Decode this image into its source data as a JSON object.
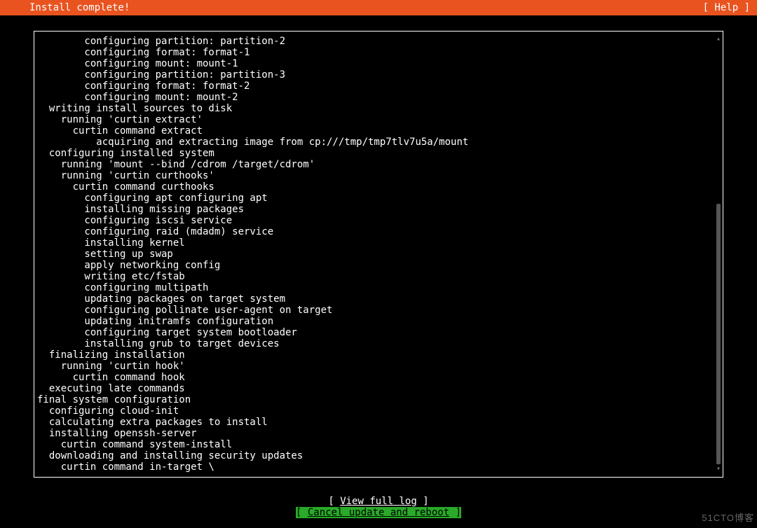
{
  "header": {
    "title": "Install complete!",
    "help": "[ Help ]"
  },
  "log": {
    "lines": [
      {
        "indent": 4,
        "text": "configuring partition: partition-2"
      },
      {
        "indent": 4,
        "text": "configuring format: format-1"
      },
      {
        "indent": 4,
        "text": "configuring mount: mount-1"
      },
      {
        "indent": 4,
        "text": "configuring partition: partition-3"
      },
      {
        "indent": 4,
        "text": "configuring format: format-2"
      },
      {
        "indent": 4,
        "text": "configuring mount: mount-2"
      },
      {
        "indent": 1,
        "text": "writing install sources to disk"
      },
      {
        "indent": 2,
        "text": "running 'curtin extract'"
      },
      {
        "indent": 3,
        "text": "curtin command extract"
      },
      {
        "indent": 5,
        "text": "acquiring and extracting image from cp:///tmp/tmp7tlv7u5a/mount"
      },
      {
        "indent": 1,
        "text": "configuring installed system"
      },
      {
        "indent": 2,
        "text": "running 'mount --bind /cdrom /target/cdrom'"
      },
      {
        "indent": 2,
        "text": "running 'curtin curthooks'"
      },
      {
        "indent": 3,
        "text": "curtin command curthooks"
      },
      {
        "indent": 4,
        "text": "configuring apt configuring apt"
      },
      {
        "indent": 4,
        "text": "installing missing packages"
      },
      {
        "indent": 4,
        "text": "configuring iscsi service"
      },
      {
        "indent": 4,
        "text": "configuring raid (mdadm) service"
      },
      {
        "indent": 4,
        "text": "installing kernel"
      },
      {
        "indent": 4,
        "text": "setting up swap"
      },
      {
        "indent": 4,
        "text": "apply networking config"
      },
      {
        "indent": 4,
        "text": "writing etc/fstab"
      },
      {
        "indent": 4,
        "text": "configuring multipath"
      },
      {
        "indent": 4,
        "text": "updating packages on target system"
      },
      {
        "indent": 4,
        "text": "configuring pollinate user-agent on target"
      },
      {
        "indent": 4,
        "text": "updating initramfs configuration"
      },
      {
        "indent": 4,
        "text": "configuring target system bootloader"
      },
      {
        "indent": 4,
        "text": "installing grub to target devices"
      },
      {
        "indent": 1,
        "text": "finalizing installation"
      },
      {
        "indent": 2,
        "text": "running 'curtin hook'"
      },
      {
        "indent": 3,
        "text": "curtin command hook"
      },
      {
        "indent": 1,
        "text": "executing late commands"
      },
      {
        "indent": 0,
        "text": "final system configuration"
      },
      {
        "indent": 1,
        "text": "configuring cloud-init"
      },
      {
        "indent": 1,
        "text": "calculating extra packages to install"
      },
      {
        "indent": 1,
        "text": "installing openssh-server"
      },
      {
        "indent": 2,
        "text": "curtin command system-install"
      },
      {
        "indent": 1,
        "text": "downloading and installing security updates"
      },
      {
        "indent": 2,
        "text": "curtin command in-target \\"
      }
    ]
  },
  "buttons": {
    "view_log_pre": "[ ",
    "view_log_label": "View full log",
    "view_log_pad": "            ]",
    "cancel_pre": "[ ",
    "cancel_label": "Cancel update and reboot",
    "cancel_post": " ]"
  },
  "watermark": "51CTO博客"
}
